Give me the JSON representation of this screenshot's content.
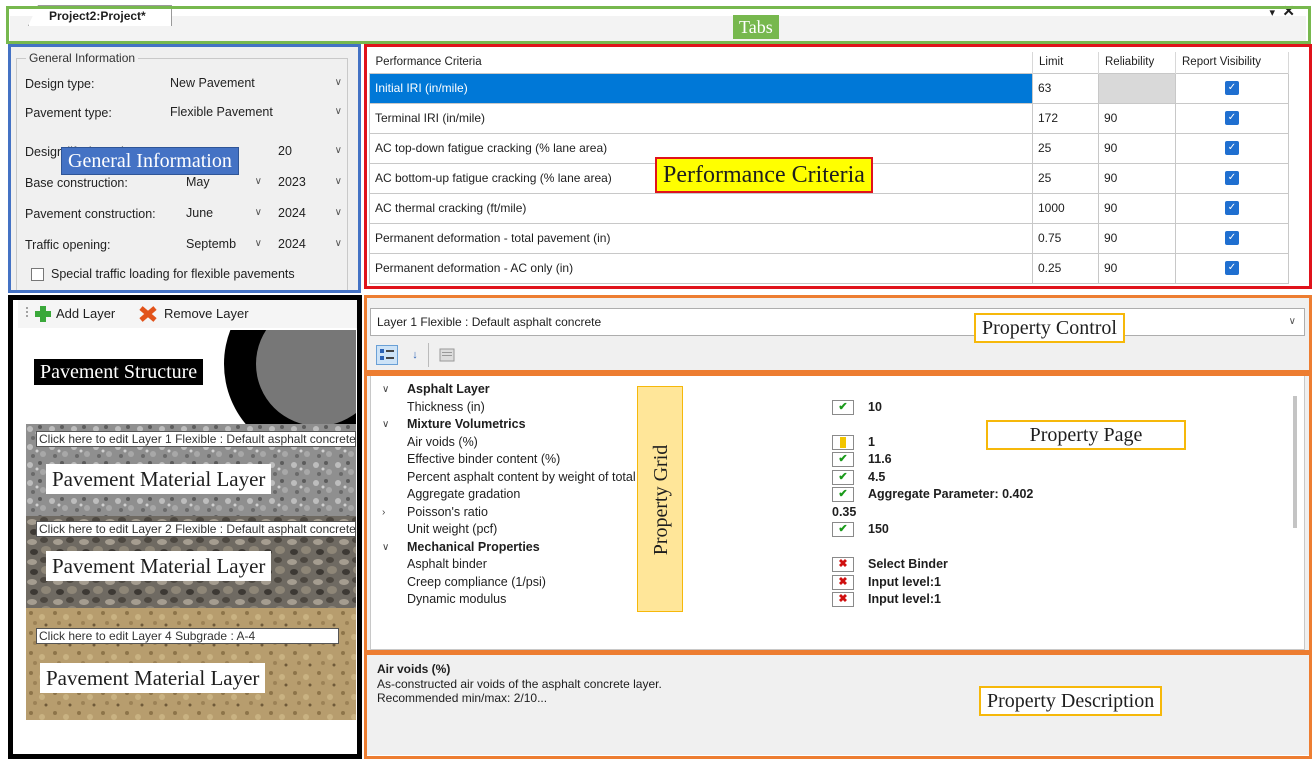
{
  "tabs": {
    "document_tab": "Project2:Project*",
    "dropdown_glyph": "▾",
    "close_glyph": "✕"
  },
  "general_information": {
    "legend": "General Information",
    "design_type": {
      "label": "Design type:",
      "value": "New Pavement"
    },
    "pavement_type": {
      "label": "Pavement type:",
      "value": "Flexible Pavement"
    },
    "design_life": {
      "label": "Design life (years):",
      "value": "20"
    },
    "base_construction": {
      "label": "Base construction:",
      "month": "May",
      "year": "2023"
    },
    "pavement_construction": {
      "label": "Pavement construction:",
      "month": "June",
      "year": "2024"
    },
    "traffic_opening": {
      "label": "Traffic opening:",
      "month": "Septemb",
      "year": "2024"
    },
    "special_traffic": {
      "label": "Special traffic loading for flexible pavements",
      "checked": false
    }
  },
  "performance_criteria": {
    "headers": [
      "Performance Criteria",
      "Limit",
      "Reliability",
      "Report Visibility"
    ],
    "rows": [
      {
        "name": "Initial IRI  (in/mile)",
        "limit": "63",
        "reliability": "",
        "visible": true,
        "selected": true
      },
      {
        "name": "Terminal IRI (in/mile)",
        "limit": "172",
        "reliability": "90",
        "visible": true
      },
      {
        "name": "AC top-down fatigue cracking (% lane area)",
        "limit": "25",
        "reliability": "90",
        "visible": true
      },
      {
        "name": "AC bottom-up fatigue cracking (% lane area)",
        "limit": "25",
        "reliability": "90",
        "visible": true
      },
      {
        "name": "AC thermal cracking (ft/mile)",
        "limit": "1000",
        "reliability": "90",
        "visible": true
      },
      {
        "name": "Permanent deformation - total pavement (in)",
        "limit": "0.75",
        "reliability": "90",
        "visible": true
      },
      {
        "name": "Permanent deformation - AC only (in)",
        "limit": "0.25",
        "reliability": "90",
        "visible": true
      }
    ]
  },
  "structure": {
    "add_layer": "Add Layer",
    "remove_layer": "Remove Layer",
    "layer_links": [
      "Click here to edit Layer 1 Flexible : Default asphalt concrete",
      "Click here to edit Layer 2 Flexible : Default asphalt concrete",
      "Click here to edit Layer 4 Subgrade : A-4"
    ]
  },
  "property_control": {
    "selected_layer": "Layer 1 Flexible : Default asphalt concrete",
    "toolbar": [
      "categorized-icon",
      "sort-az-icon",
      "property-pages-icon"
    ]
  },
  "property_grid": {
    "rows": [
      {
        "type": "category",
        "name": "Asphalt Layer",
        "expander": "∨"
      },
      {
        "type": "prop",
        "name": "Thickness (in)",
        "marker": "ok",
        "value": "10"
      },
      {
        "type": "category",
        "name": "Mixture Volumetrics",
        "expander": "∨"
      },
      {
        "type": "prop",
        "name": "Air voids (%)",
        "marker": "warn",
        "value": "1"
      },
      {
        "type": "prop",
        "name": "Effective binder content (%)",
        "marker": "ok",
        "value": "11.6"
      },
      {
        "type": "prop",
        "name": "Percent asphalt content by weight of total mix (%)",
        "marker": "ok",
        "value": "4.5"
      },
      {
        "type": "prop",
        "name": "Aggregate gradation",
        "marker": "ok",
        "value": "Aggregate Parameter: 0.402"
      },
      {
        "type": "prop",
        "name": "Poisson's ratio",
        "marker": "",
        "value": "0.35",
        "expander": "›"
      },
      {
        "type": "prop",
        "name": "Unit weight (pcf)",
        "marker": "ok",
        "value": "150"
      },
      {
        "type": "category",
        "name": "Mechanical Properties",
        "expander": "∨"
      },
      {
        "type": "prop",
        "name": "Asphalt binder",
        "marker": "err",
        "value": "Select Binder"
      },
      {
        "type": "prop",
        "name": "Creep compliance (1/psi)",
        "marker": "err",
        "value": "Input level:1"
      },
      {
        "type": "prop",
        "name": "Dynamic modulus",
        "marker": "err",
        "value": "Input level:1"
      }
    ],
    "markers": {
      "ok": "✔",
      "warn": "!",
      "err": "✖"
    }
  },
  "property_description": {
    "title": "Air voids (%)",
    "text": "As-constructed air voids of the asphalt concrete layer.",
    "recommendation": "Recommended  min/max:  2/10..."
  },
  "annotations": {
    "tabs": "Tabs",
    "general_information": "General Information",
    "performance_criteria": "Performance Criteria",
    "pavement_structure": "Pavement Structure",
    "material_layer": "Pavement Material Layer",
    "property_control": "Property Control",
    "property_page": "Property Page",
    "property_grid": "Property Grid",
    "property_description": "Property Description"
  },
  "colors": {
    "tabs_box": "#77b84e",
    "general_box": "#4472c4",
    "performance_box": "#e0131b",
    "structure_box": "#000000",
    "property_box": "#ed7d31",
    "label_fill": "#ffff00",
    "label_border": "#f6b80a",
    "selection_blue": "#0078d7"
  }
}
